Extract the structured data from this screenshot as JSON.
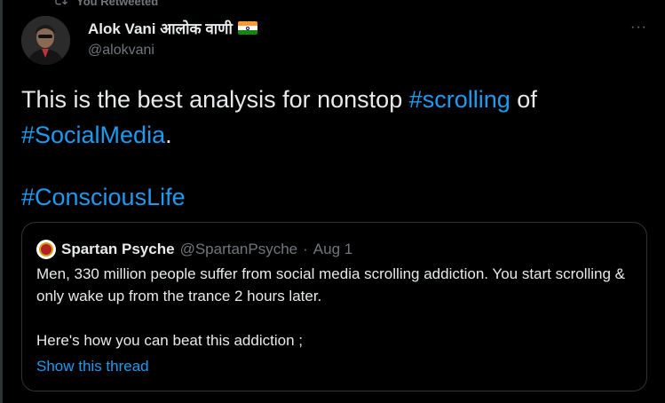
{
  "retweet_context": {
    "label": "You Retweeted",
    "icon": "retweet-icon"
  },
  "author": {
    "display_name": "Alok Vani आलोक वाणी",
    "handle": "@alokvani",
    "flag": "india-flag-emoji"
  },
  "more_menu": {
    "label": "···"
  },
  "tweet": {
    "line1_prefix": "This is the best analysis for nonstop ",
    "hashtag_scrolling": "#scrolling",
    "line1_suffix": " of",
    "hashtag_socialmedia": "#SocialMedia",
    "line2_suffix": ".",
    "hashtag_consciouslife": "#ConsciousLife"
  },
  "quoted_tweet": {
    "display_name": "Spartan Psyche",
    "handle": "@SpartanPsyche",
    "separator": "·",
    "date": "Aug 1",
    "paragraph1": "Men, 330 million people suffer from social media scrolling addiction. You start scrolling & only wake up from the trance 2 hours later.",
    "paragraph2": "Here's how you can beat this addiction ;",
    "show_thread": "Show this thread"
  },
  "colors": {
    "background": "#000000",
    "text": "#e7e9ea",
    "secondary": "#71767b",
    "accent": "#1d9bf0",
    "border": "#2f3336"
  }
}
